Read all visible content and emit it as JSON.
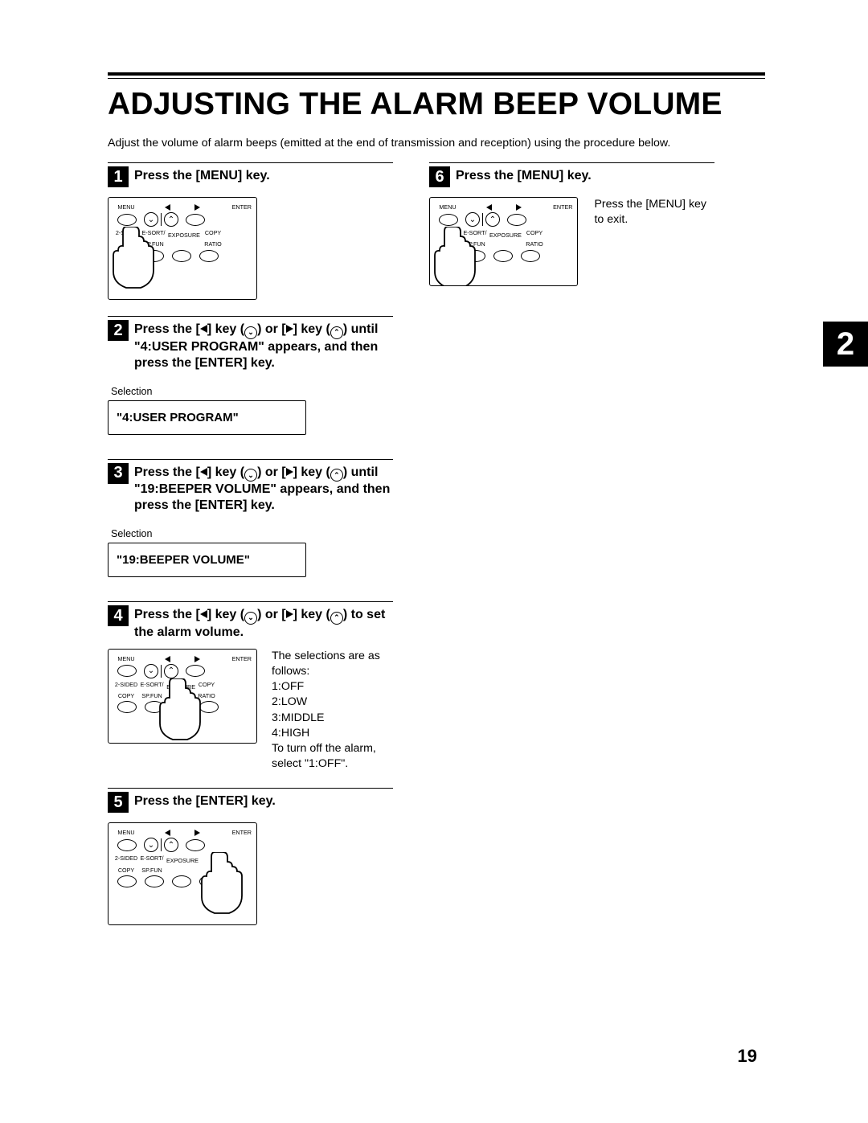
{
  "page_number": "19",
  "section_tab": "2",
  "title": "ADJUSTING THE ALARM BEEP VOLUME",
  "intro": "Adjust the volume of alarm beeps (emitted at the end of transmission and reception) using the procedure below.",
  "steps": {
    "1": {
      "num": "1",
      "title": "Press the [MENU] key."
    },
    "2": {
      "num": "2",
      "title_pre": "Press the [",
      "title_mid1": "] key (",
      "title_mid2": ") or [",
      "title_mid3": "] key (",
      "title_post": ") until \"4:USER PROGRAM\" appears, and then press the [ENTER] key.",
      "selection_label": "Selection",
      "display": "\"4:USER PROGRAM\""
    },
    "3": {
      "num": "3",
      "title_pre": "Press the [",
      "title_mid1": "] key (",
      "title_mid2": ") or [",
      "title_mid3": "] key (",
      "title_post": ") until \"19:BEEPER VOLUME\" appears, and then press the [ENTER] key.",
      "selection_label": "Selection",
      "display": "\"19:BEEPER VOLUME\""
    },
    "4": {
      "num": "4",
      "title_pre": "Press the [",
      "title_mid1": "] key (",
      "title_mid2": ") or [",
      "title_mid3": "] key (",
      "title_post": ") to set the alarm volume.",
      "body_intro": "The selections are as follows:",
      "opts": [
        "1:OFF",
        "2:LOW",
        "3:MIDDLE",
        "4:HIGH"
      ],
      "body_out": "To turn off the alarm, select \"1:OFF\"."
    },
    "5": {
      "num": "5",
      "title": "Press the [ENTER] key."
    },
    "6": {
      "num": "6",
      "title": "Press the [MENU] key.",
      "body": "Press the [MENU] key to exit."
    }
  },
  "panel_labels": {
    "menu": "MENU",
    "enter": "ENTER",
    "l1": "2-SIDED",
    "l1b": "COPY",
    "l2": "E-SORT/",
    "l2b": "SP.FUN",
    "l3": "EXPOSURE",
    "l4": "COPY",
    "l4b": "RATIO",
    "l3_alt_a": "EX",
    "l3_alt_b": "URE"
  }
}
